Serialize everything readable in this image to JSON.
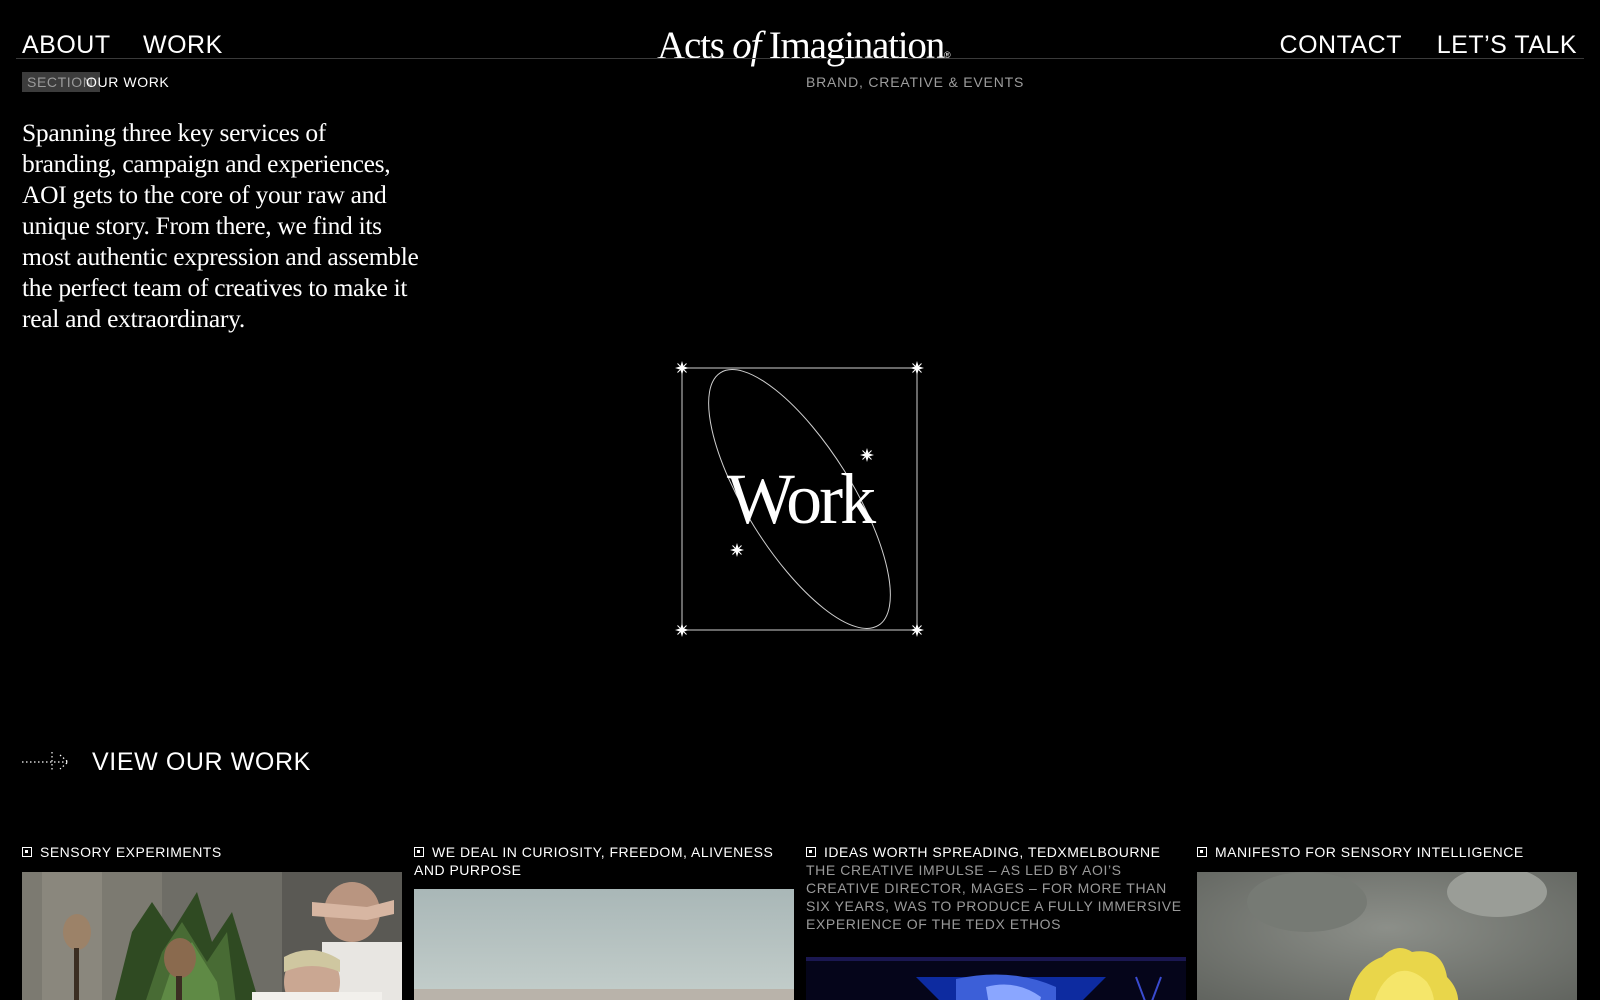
{
  "nav": {
    "about": "ABOUT",
    "work": "WORK",
    "contact": "CONTACT",
    "lets_talk": "LET’S TALK"
  },
  "logo": {
    "part1": "Acts",
    "part2": "of",
    "part3": "Imagination",
    "mark": "®"
  },
  "section": {
    "badge": "SECTION",
    "title": "OUR WORK"
  },
  "tagline": "BRAND, CREATIVE & EVENTS",
  "intro": "Spanning three key services of branding, campaign and experiences, AOI gets to the core of your raw and unique story. From there, we find its most authentic expression and assemble the perfect team of creatives to make it real and extraordinary.",
  "emblem": {
    "word": "Work"
  },
  "cta": {
    "label": "VIEW OUR WORK",
    "icon": "dotted-arrow-icon"
  },
  "cards": [
    {
      "title": "SENSORY EXPERIMENTS",
      "description": ""
    },
    {
      "title": "WE DEAL IN CURIOSITY, FREEDOM, ALIVENESS AND PURPOSE",
      "description": ""
    },
    {
      "title": "IDEAS WORTH SPREADING, TEDXMELBOURNE",
      "description": "THE CREATIVE IMPULSE – AS LED BY AOI’S CREATIVE DIRECTOR, MAGES – FOR MORE THAN SIX YEARS, WAS TO PRODUCE A FULLY IMMERSIVE EXPERIENCE OF THE TEDX ETHOS"
    },
    {
      "title": "MANIFESTO FOR SENSORY INTELLIGENCE",
      "description": ""
    }
  ],
  "colors": {
    "background": "#000000",
    "text": "#ffffff",
    "muted": "#9a9a9a",
    "badge": "#3c3c3c"
  }
}
